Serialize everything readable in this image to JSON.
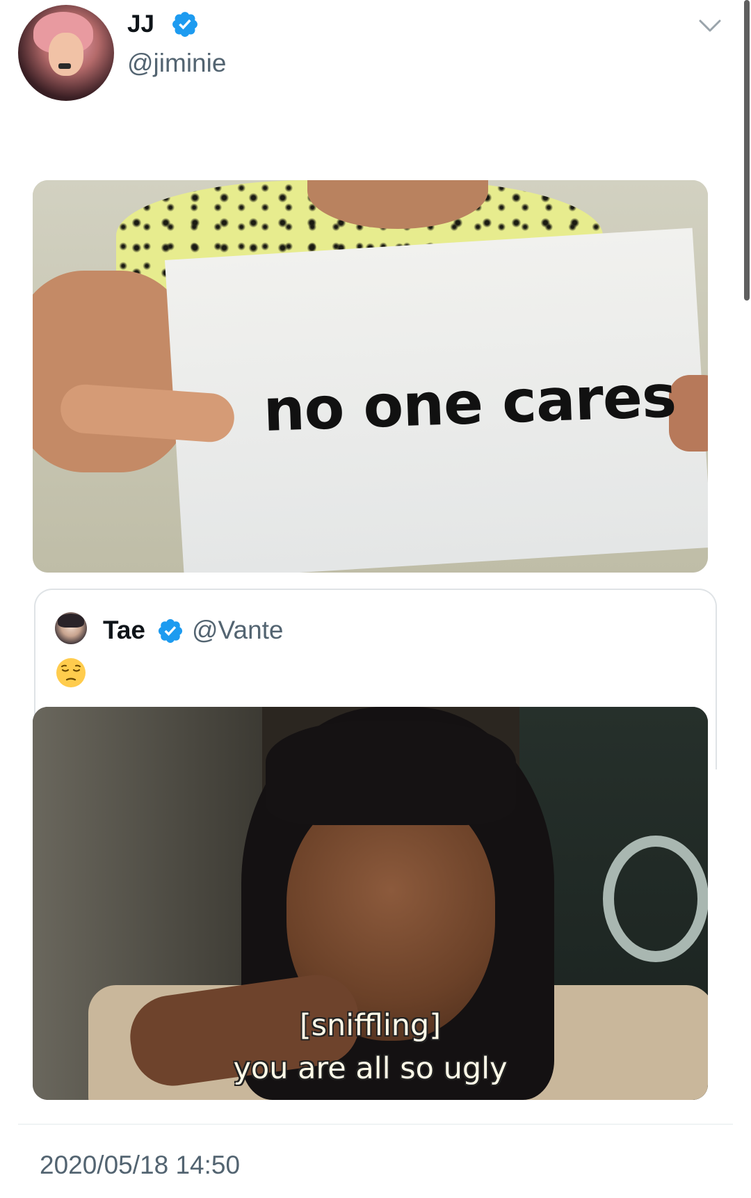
{
  "tweet": {
    "author": {
      "display_name": "JJ",
      "handle": "@jiminie",
      "verified": true,
      "avatar": "avatar"
    },
    "menu_icon": "chevron-down-icon",
    "image_1": {
      "sign_text": "no one cares"
    },
    "quoted_tweet": {
      "author": {
        "display_name": "Tae",
        "handle": "@Vante",
        "verified": true
      },
      "text_emoji": "pensive-face-emoji",
      "image_caption_line_1": "[sniffling]",
      "image_caption_line_2": "you are all so ugly"
    },
    "timestamp": "2020/05/18 14:50"
  },
  "colors": {
    "verified_blue": "#1d9bf0",
    "secondary_text": "#536471",
    "primary_text": "#0f1419",
    "border": "#dfe3e6"
  }
}
